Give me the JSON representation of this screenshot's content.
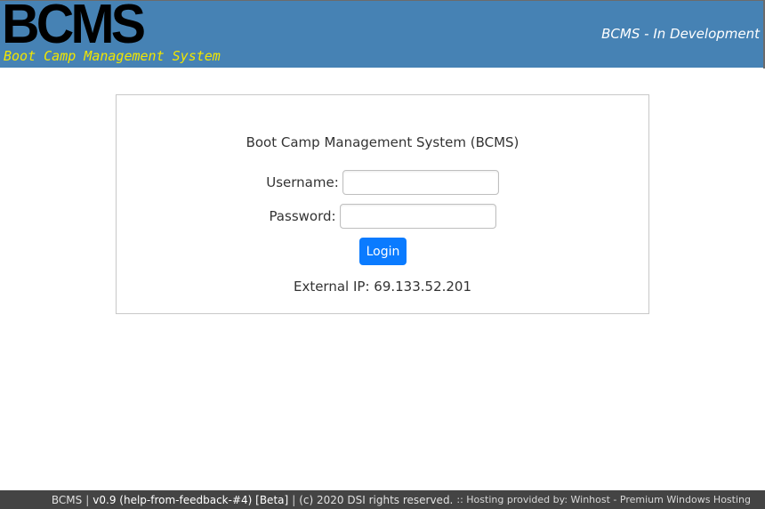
{
  "header": {
    "logo": "BCMS",
    "tagline": "Boot Camp Management System",
    "environment": "BCMS - In Development"
  },
  "login": {
    "title": "Boot Camp Management System (BCMS)",
    "username_label": "Username:",
    "username_value": "",
    "password_label": "Password:",
    "password_value": "",
    "login_button": "Login",
    "external_ip_label": "External IP:",
    "external_ip_value": "69.133.52.201"
  },
  "footer": {
    "app_name": "BCMS",
    "separator": "|",
    "version": "v0.9 (help-from-feedback-#4) [Beta]",
    "copyright": "(c) 2020 DSI rights reserved.",
    "hosting": ":: Hosting provided by: Winhost - Premium Windows Hosting"
  },
  "colors": {
    "header_bg": "#4682b4",
    "tagline": "#f2e600",
    "button_bg": "#0a7bff",
    "footer_bg": "#444444"
  }
}
